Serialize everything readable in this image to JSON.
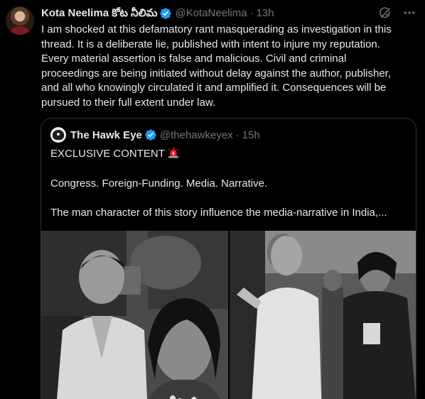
{
  "tweet": {
    "display_name": "Kota Neelima కోట నీలిమ",
    "handle": "@KotaNeelima",
    "separator": "·",
    "time": "13h",
    "lines": [
      "I am shocked at this defamatory rant masquerading as investigation in this",
      "thread. It is a deliberate lie, published with intent to injure my reputation.",
      "Every material assertion is false and malicious. Civil and criminal",
      "proceedings are being initiated without delay against the author, publisher,",
      "and all who knowingly circulated it and amplified it. Consequences will be",
      "pursued to their full extent under law."
    ]
  },
  "quote": {
    "display_name": "The Hawk Eye",
    "handle": "@thehawkeyex",
    "separator": "·",
    "time": "15h",
    "line1": "EXCLUSIVE CONTENT",
    "line2": "Congress. Foreign-Funding. Media. Narrative.",
    "line3": "The man character of this story influence the media-narrative in India,..."
  },
  "icons": {
    "verified": "verified-badge-icon",
    "grok": "grok-icon",
    "more": "more-icon",
    "siren": "siren-emoji"
  },
  "colors": {
    "background": "#000000",
    "text": "#e7e9ea",
    "muted": "#71767b",
    "verified": "#1d9bf0",
    "border": "#2f3336"
  }
}
